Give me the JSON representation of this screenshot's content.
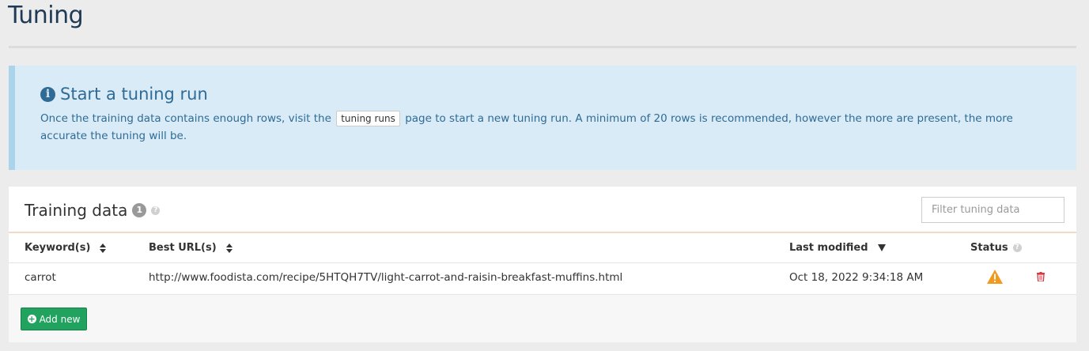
{
  "page": {
    "title": "Tuning"
  },
  "callout": {
    "title": "Start a tuning run",
    "text_before": "Once the training data contains enough rows, visit the",
    "link_label": "tuning runs",
    "text_after": "page to start a new tuning run. A minimum of 20 rows is recommended, however the more are present, the more accurate the tuning will be."
  },
  "training": {
    "title": "Training data",
    "count": "1",
    "filter_placeholder": "Filter tuning data",
    "columns": {
      "keywords": "Keyword(s)",
      "best_urls": "Best URL(s)",
      "last_modified": "Last modified",
      "status": "Status"
    },
    "rows": [
      {
        "keywords": "carrot",
        "best_url": "http://www.foodista.com/recipe/5HTQH7TV/light-carrot-and-raisin-breakfast-muffins.html",
        "last_modified": "Oct 18, 2022 9:34:18 AM",
        "status_icon": "warning-icon"
      }
    ],
    "add_label": "Add new"
  },
  "colors": {
    "title": "#1f3a55",
    "callout_bg": "#d9ebf7",
    "callout_text": "#2f6b95",
    "add_button": "#21a35f",
    "warning": "#f39a1e",
    "delete": "#d9363e"
  }
}
